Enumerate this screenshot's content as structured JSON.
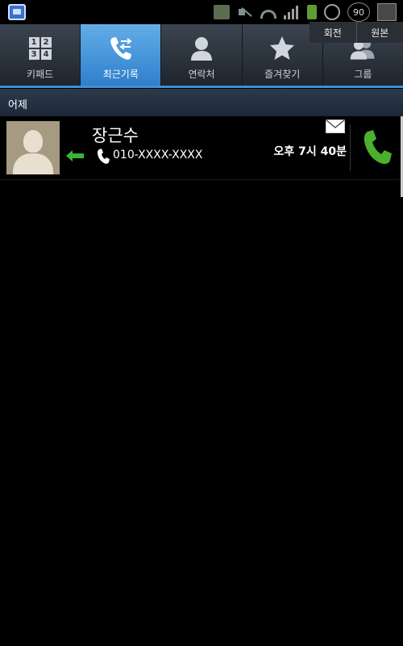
{
  "status_bar": {
    "battery_percent": "90",
    "icons": [
      "app-notification-icon",
      "image-icon",
      "mute-icon",
      "wifi-icon",
      "signal-icon",
      "battery-icon",
      "alarm-icon",
      "screenshot-icon"
    ]
  },
  "rotate_buttons": {
    "rotate": "회전",
    "original": "원본"
  },
  "tabs": [
    {
      "label": "키패드",
      "icon": "keypad-icon",
      "active": false
    },
    {
      "label": "최근기록",
      "icon": "recent-calls-icon",
      "active": true
    },
    {
      "label": "연락처",
      "icon": "contact-icon",
      "active": false
    },
    {
      "label": "즐겨찾기",
      "icon": "star-icon",
      "active": false
    },
    {
      "label": "그룹",
      "icon": "group-icon",
      "active": false
    }
  ],
  "section": {
    "label": "어제"
  },
  "call_log": [
    {
      "name": "장근수",
      "number": "010-XXXX-XXXX",
      "time": "오후 7시 40분",
      "type": "incoming",
      "icons": [
        "avatar",
        "incoming-arrow-icon",
        "phone-icon",
        "message-icon",
        "call-icon"
      ]
    }
  ],
  "colors": {
    "accent": "#3d8fd6",
    "active_tab": "#4a9ae0",
    "call_green": "#4bb02c",
    "incoming_arrow": "#3cb334"
  },
  "keypad_digits": [
    "1",
    "2",
    "3",
    "4"
  ]
}
